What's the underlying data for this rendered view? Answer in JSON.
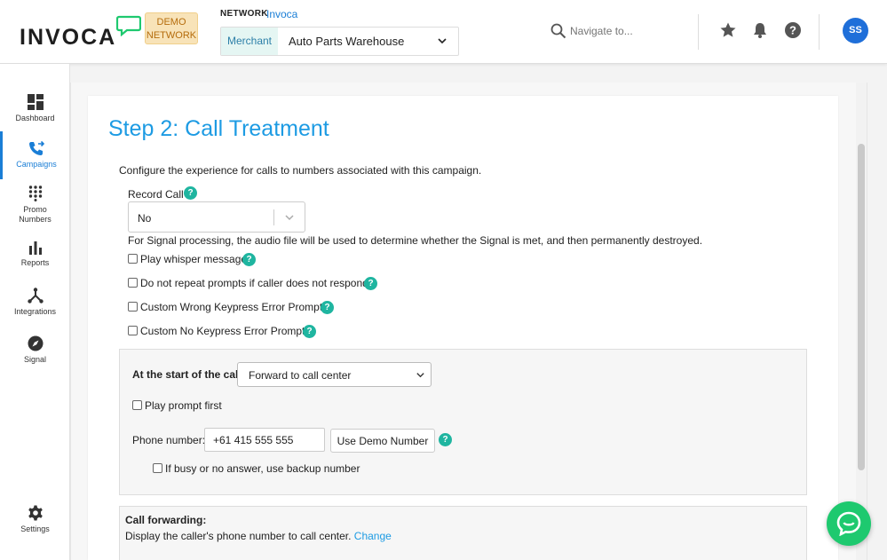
{
  "header": {
    "logo_text": "INVOCA",
    "demo_badge": "DEMO NETWORK",
    "network_label": "NETWORK",
    "network_value": "Invoca",
    "merchant_tag": "Merchant",
    "merchant_value": "Auto Parts Warehouse",
    "search_placeholder": "Navigate to...",
    "avatar_initials": "SS"
  },
  "sidebar": {
    "items": [
      {
        "label": "Dashboard",
        "icon": "dashboard-icon"
      },
      {
        "label": "Campaigns",
        "icon": "phone-forward-icon",
        "active": true
      },
      {
        "label": "Promo Numbers",
        "icon": "keypad-icon"
      },
      {
        "label": "Reports",
        "icon": "bar-chart-icon"
      },
      {
        "label": "Integrations",
        "icon": "integrations-icon"
      },
      {
        "label": "Signal",
        "icon": "compass-icon"
      },
      {
        "label": "Settings",
        "icon": "gear-icon"
      }
    ]
  },
  "page": {
    "title": "Step 2: Call Treatment",
    "intro": "Configure the experience for calls to numbers associated with this campaign.",
    "record_call_label": "Record Call",
    "record_call_value": "No",
    "signal_note": "For Signal processing, the audio file will be used to determine whether the Signal is met, and then permanently destroyed.",
    "options": [
      {
        "label": "Play whisper message",
        "checked": false,
        "help": true
      },
      {
        "label": "Do not repeat prompts if caller does not respond",
        "checked": false,
        "help": true
      },
      {
        "label": "Custom Wrong Keypress Error Prompt",
        "checked": false,
        "help": true
      },
      {
        "label": "Custom No Keypress Error Prompt",
        "checked": false,
        "help": true
      }
    ],
    "start": {
      "label": "At the start of the call",
      "action_value": "Forward to call center",
      "play_prompt_label": "Play prompt first",
      "phone_label": "Phone number:",
      "phone_value": "+61 415 555 555",
      "demo_button": "Use Demo Number",
      "backup_label": "If busy or no answer, use backup number"
    },
    "forwarding": {
      "title": "Call forwarding:",
      "text": "Display the caller's phone number to call center.",
      "link": "Change"
    },
    "help_glyph": "?"
  },
  "colors": {
    "accent": "#1d9be3",
    "help": "#1fb5a0",
    "chat": "#1ec96f",
    "avatar": "#1f6fd9"
  }
}
